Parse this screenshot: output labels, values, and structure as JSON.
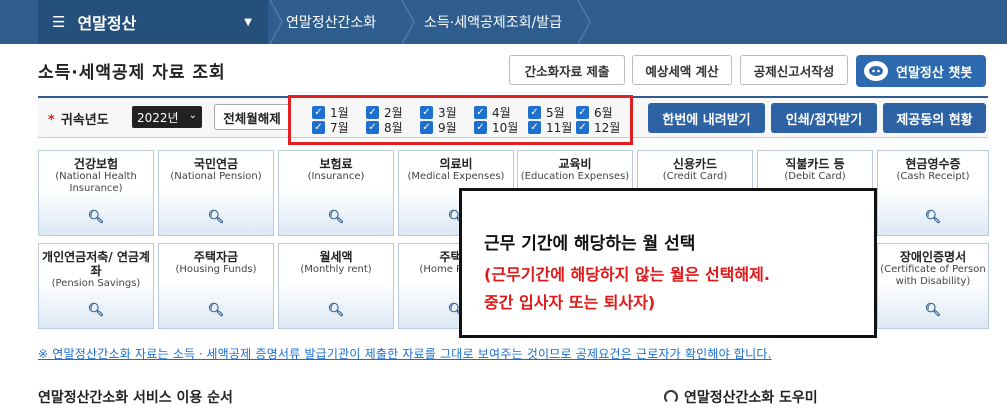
{
  "topnav": {
    "menu_label": "연말정산",
    "crumbs": [
      "연말정산간소화",
      "소득·세액공제조회/발급"
    ]
  },
  "page": {
    "title": "소득·세액공제 자료 조회"
  },
  "toolbar": {
    "btn1": "간소화자료 제출",
    "btn2": "예상세액 계산",
    "btn3": "공제신고서작성",
    "chatbot": "연말정산 챗봇"
  },
  "filter": {
    "year_label": "귀속년도",
    "year_value": "2022년",
    "select_all": "전체월해제",
    "months_row1": [
      "1월",
      "2월",
      "3월",
      "4월",
      "5월",
      "6월"
    ],
    "months_row2": [
      "7월",
      "8월",
      "9월",
      "10월",
      "11월",
      "12월"
    ],
    "download_all": "한번에 내려받기",
    "print_braille": "인쇄/점자받기",
    "provide_status": "제공동의 현황"
  },
  "cards_row1": [
    {
      "kr": "건강보험",
      "en": "(National Health Insurance)"
    },
    {
      "kr": "국민연금",
      "en": "(National Pension)"
    },
    {
      "kr": "보험료",
      "en": "(Insurance)"
    },
    {
      "kr": "의료비",
      "en": "(Medical Expenses)"
    },
    {
      "kr": "교육비",
      "en": "(Education Expenses)"
    },
    {
      "kr": "신용카드",
      "en": "(Credit Card)"
    },
    {
      "kr": "직불카드 등",
      "en": "(Debit Card)"
    },
    {
      "kr": "현금영수증",
      "en": "(Cash Receipt)"
    }
  ],
  "cards_row2": [
    {
      "kr": "개인연금저축/ 연금계좌",
      "en": "(Pension Savings)"
    },
    {
      "kr": "주택자금",
      "en": "(Housing Funds)"
    },
    {
      "kr": "월세액",
      "en": "(Monthly rent)"
    },
    {
      "kr": "주택마",
      "en": "(Home Pu Savi"
    },
    {
      "kr": "",
      "en": ""
    },
    {
      "kr": "",
      "en": ""
    },
    {
      "kr": "",
      "en": ""
    },
    {
      "kr": "장애인증명서",
      "en": "(Certificate of Person with Disability)"
    }
  ],
  "overlay": {
    "line1": "근무 기간에 해당하는 월 선택",
    "line2": "(근무기간에 해당하지 않는 월은 선택해제.",
    "line3": "중간 입사자 또는 퇴사자)"
  },
  "notice": "※ 연말정산간소화 자료는 소득ㆍ세액공제 증명서류 발급기관이 제출한 자료를 그대로 보여주는 것이므로 공제요건은 근로자가 확인해야 합니다.",
  "bottom": {
    "left": "연말정산간소화 서비스 이용 순서",
    "right": "연말정산간소화 도우미"
  },
  "colors": {
    "nav": "#2e5d8e",
    "accent": "#2d63a4",
    "highlight": "#e32020"
  }
}
